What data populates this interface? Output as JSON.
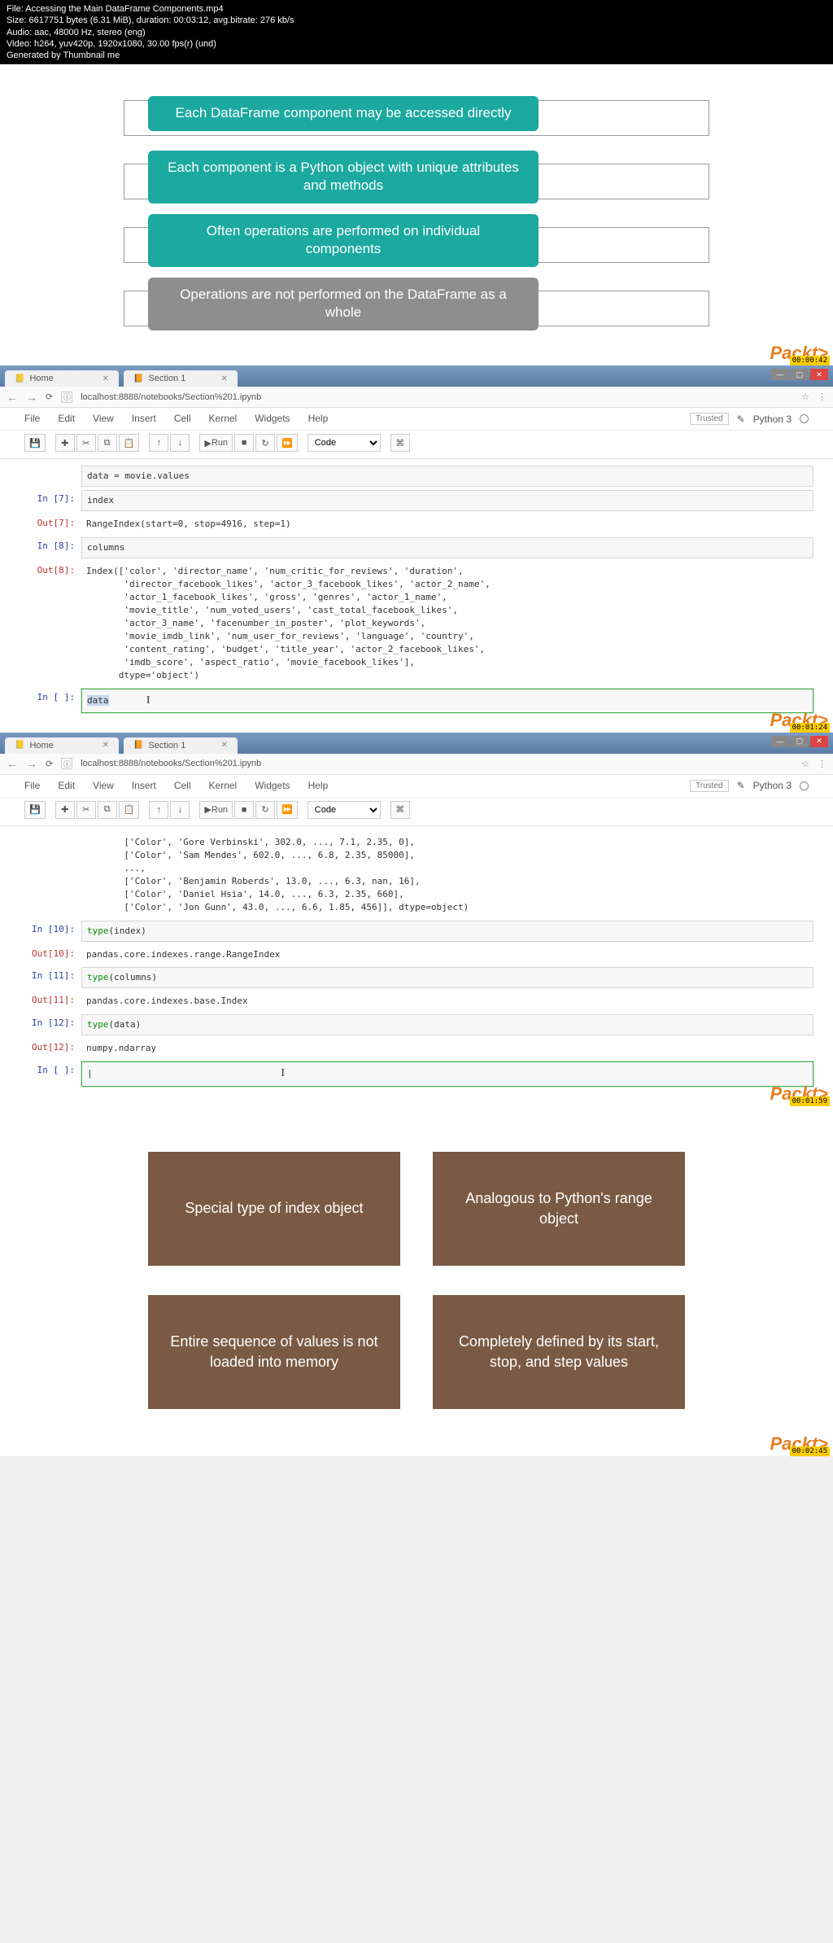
{
  "video_meta": {
    "file": "File: Accessing the Main DataFrame Components.mp4",
    "size": "Size: 6617751 bytes (6.31 MiB), duration: 00:03:12, avg.bitrate: 276 kb/s",
    "audio": "Audio: aac, 48000 Hz, stereo (eng)",
    "video": "Video: h264, yuv420p, 1920x1080, 30.00 fps(r) (und)",
    "generated": "Generated by Thumbnail me"
  },
  "slide1_pills": [
    "Each DataFrame component may be accessed directly",
    "Each component is a Python object with unique attributes and methods",
    "Often operations are performed on individual components",
    "Operations are not performed on the DataFrame as a whole"
  ],
  "packt": "Packt>",
  "timestamps": {
    "t1": "00:00:42",
    "t2": "00:01:24",
    "t3": "00:01:59",
    "t4": "00:02:45"
  },
  "browser": {
    "tab1": "Home",
    "tab2": "Section 1",
    "url": "localhost:8888/notebooks/Section%201.ipynb"
  },
  "jupyter": {
    "menu": [
      "File",
      "Edit",
      "View",
      "Insert",
      "Cell",
      "Kernel",
      "Widgets",
      "Help"
    ],
    "trusted": "Trusted",
    "kernel": "Python 3",
    "run": "Run",
    "celltype": "Code"
  },
  "nb1": {
    "code_snippet": "data = movie.values",
    "in7": "In [7]:",
    "in7_code": "index",
    "out7": "Out[7]:",
    "out7_text": "RangeIndex(start=0, stop=4916, step=1)",
    "in8": "In [8]:",
    "in8_code": "columns",
    "out8": "Out[8]:",
    "in_empty": "In [ ]:",
    "in_empty_code": "data"
  },
  "nb2": {
    "in10": "In [10]:",
    "in10_code": "type(index)",
    "out10": "Out[10]:",
    "out10_text": "pandas.core.indexes.range.RangeIndex",
    "in11": "In [11]:",
    "in11_code": "type(columns)",
    "out11": "Out[11]:",
    "out11_text": "pandas.core.indexes.base.Index",
    "in12": "In [12]:",
    "in12_code": "type(data)",
    "out12": "Out[12]:",
    "out12_text": "numpy.ndarray",
    "in_empty": "In [ ]:"
  },
  "slide4_boxes": [
    "Special type of index object",
    "Analogous to Python's range object",
    "Entire sequence of values is not loaded into memory",
    "Completely defined by its start, stop, and step values"
  ],
  "chart_data": {
    "type": "table",
    "notebook1_out8_index_columns": [
      "color",
      "director_name",
      "num_critic_for_reviews",
      "duration",
      "director_facebook_likes",
      "actor_3_facebook_likes",
      "actor_2_name",
      "actor_1_facebook_likes",
      "gross",
      "genres",
      "actor_1_name",
      "movie_title",
      "num_voted_users",
      "cast_total_facebook_likes",
      "actor_3_name",
      "facenumber_in_poster",
      "plot_keywords",
      "movie_imdb_link",
      "num_user_for_reviews",
      "language",
      "country",
      "content_rating",
      "budget",
      "title_year",
      "actor_2_facebook_likes",
      "imdb_score",
      "aspect_ratio",
      "movie_facebook_likes"
    ],
    "notebook1_out8_dtype": "object",
    "notebook2_data_array_sample": [
      [
        "Color",
        "Gore Verbinski",
        302.0,
        "...",
        7.1,
        2.35,
        0
      ],
      [
        "Color",
        "Sam Mendes",
        602.0,
        "...",
        6.8,
        2.35,
        85000
      ],
      "...",
      [
        "Color",
        "Benjamin Roberds",
        13.0,
        "...",
        6.3,
        "nan",
        16
      ],
      [
        "Color",
        "Daniel Hsia",
        14.0,
        "...",
        6.3,
        2.35,
        660
      ],
      [
        "Color",
        "Jon Gunn",
        43.0,
        "...",
        6.6,
        1.85,
        456
      ]
    ],
    "notebook2_data_array_dtype": "object"
  }
}
